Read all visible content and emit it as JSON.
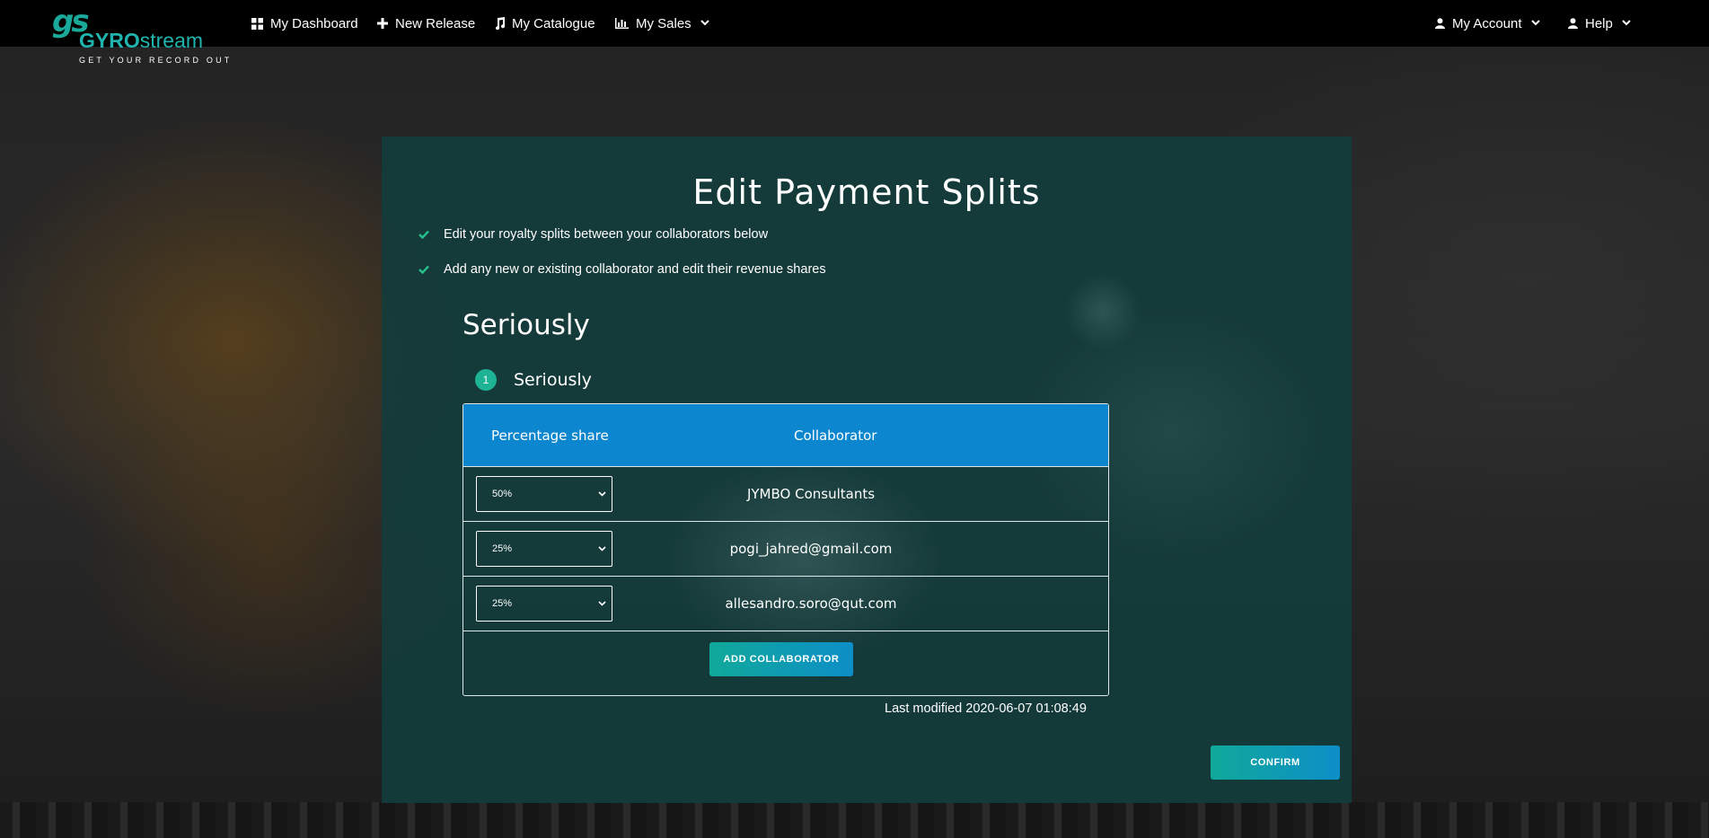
{
  "brand": {
    "mark": "gs",
    "name_bold": "GYRO",
    "name_rest": "stream",
    "tagline": "GET YOUR RECORD OUT",
    "color": "#1fb5ae"
  },
  "nav": {
    "dashboard": {
      "label": "My Dashboard",
      "icon": "grid-icon"
    },
    "new_release": {
      "label": "New Release",
      "icon": "plus-icon"
    },
    "catalogue": {
      "label": "My Catalogue",
      "icon": "music-note-icon"
    },
    "sales": {
      "label": "My Sales",
      "icon": "bar-chart-icon"
    },
    "account": {
      "label": "My Account",
      "icon": "user-icon"
    },
    "help": {
      "label": "Help",
      "icon": "user-icon"
    }
  },
  "page": {
    "title": "Edit Payment Splits",
    "checklist": [
      "Edit your royalty splits between your collaborators below",
      "Add any new or existing collaborator and edit their revenue shares"
    ],
    "release_title": "Seriously",
    "track": {
      "number": "1",
      "title": "Seriously"
    }
  },
  "table": {
    "headers": {
      "share": "Percentage share",
      "collaborator": "Collaborator"
    },
    "rows": [
      {
        "share": "50%",
        "collaborator": "JYMBO Consultants"
      },
      {
        "share": "25%",
        "collaborator": "pogi_jahred@gmail.com"
      },
      {
        "share": "25%",
        "collaborator": "allesandro.soro@qut.com"
      }
    ],
    "add_label": "ADD COLLABORATOR"
  },
  "last_modified": {
    "label": "Last modified",
    "value": "2020-06-07 01:08:49"
  },
  "confirm_label": "CONFIRM",
  "colors": {
    "header_blue": "#0b86cf",
    "accent_green": "#1db394",
    "card_bg": "#143c3c"
  }
}
